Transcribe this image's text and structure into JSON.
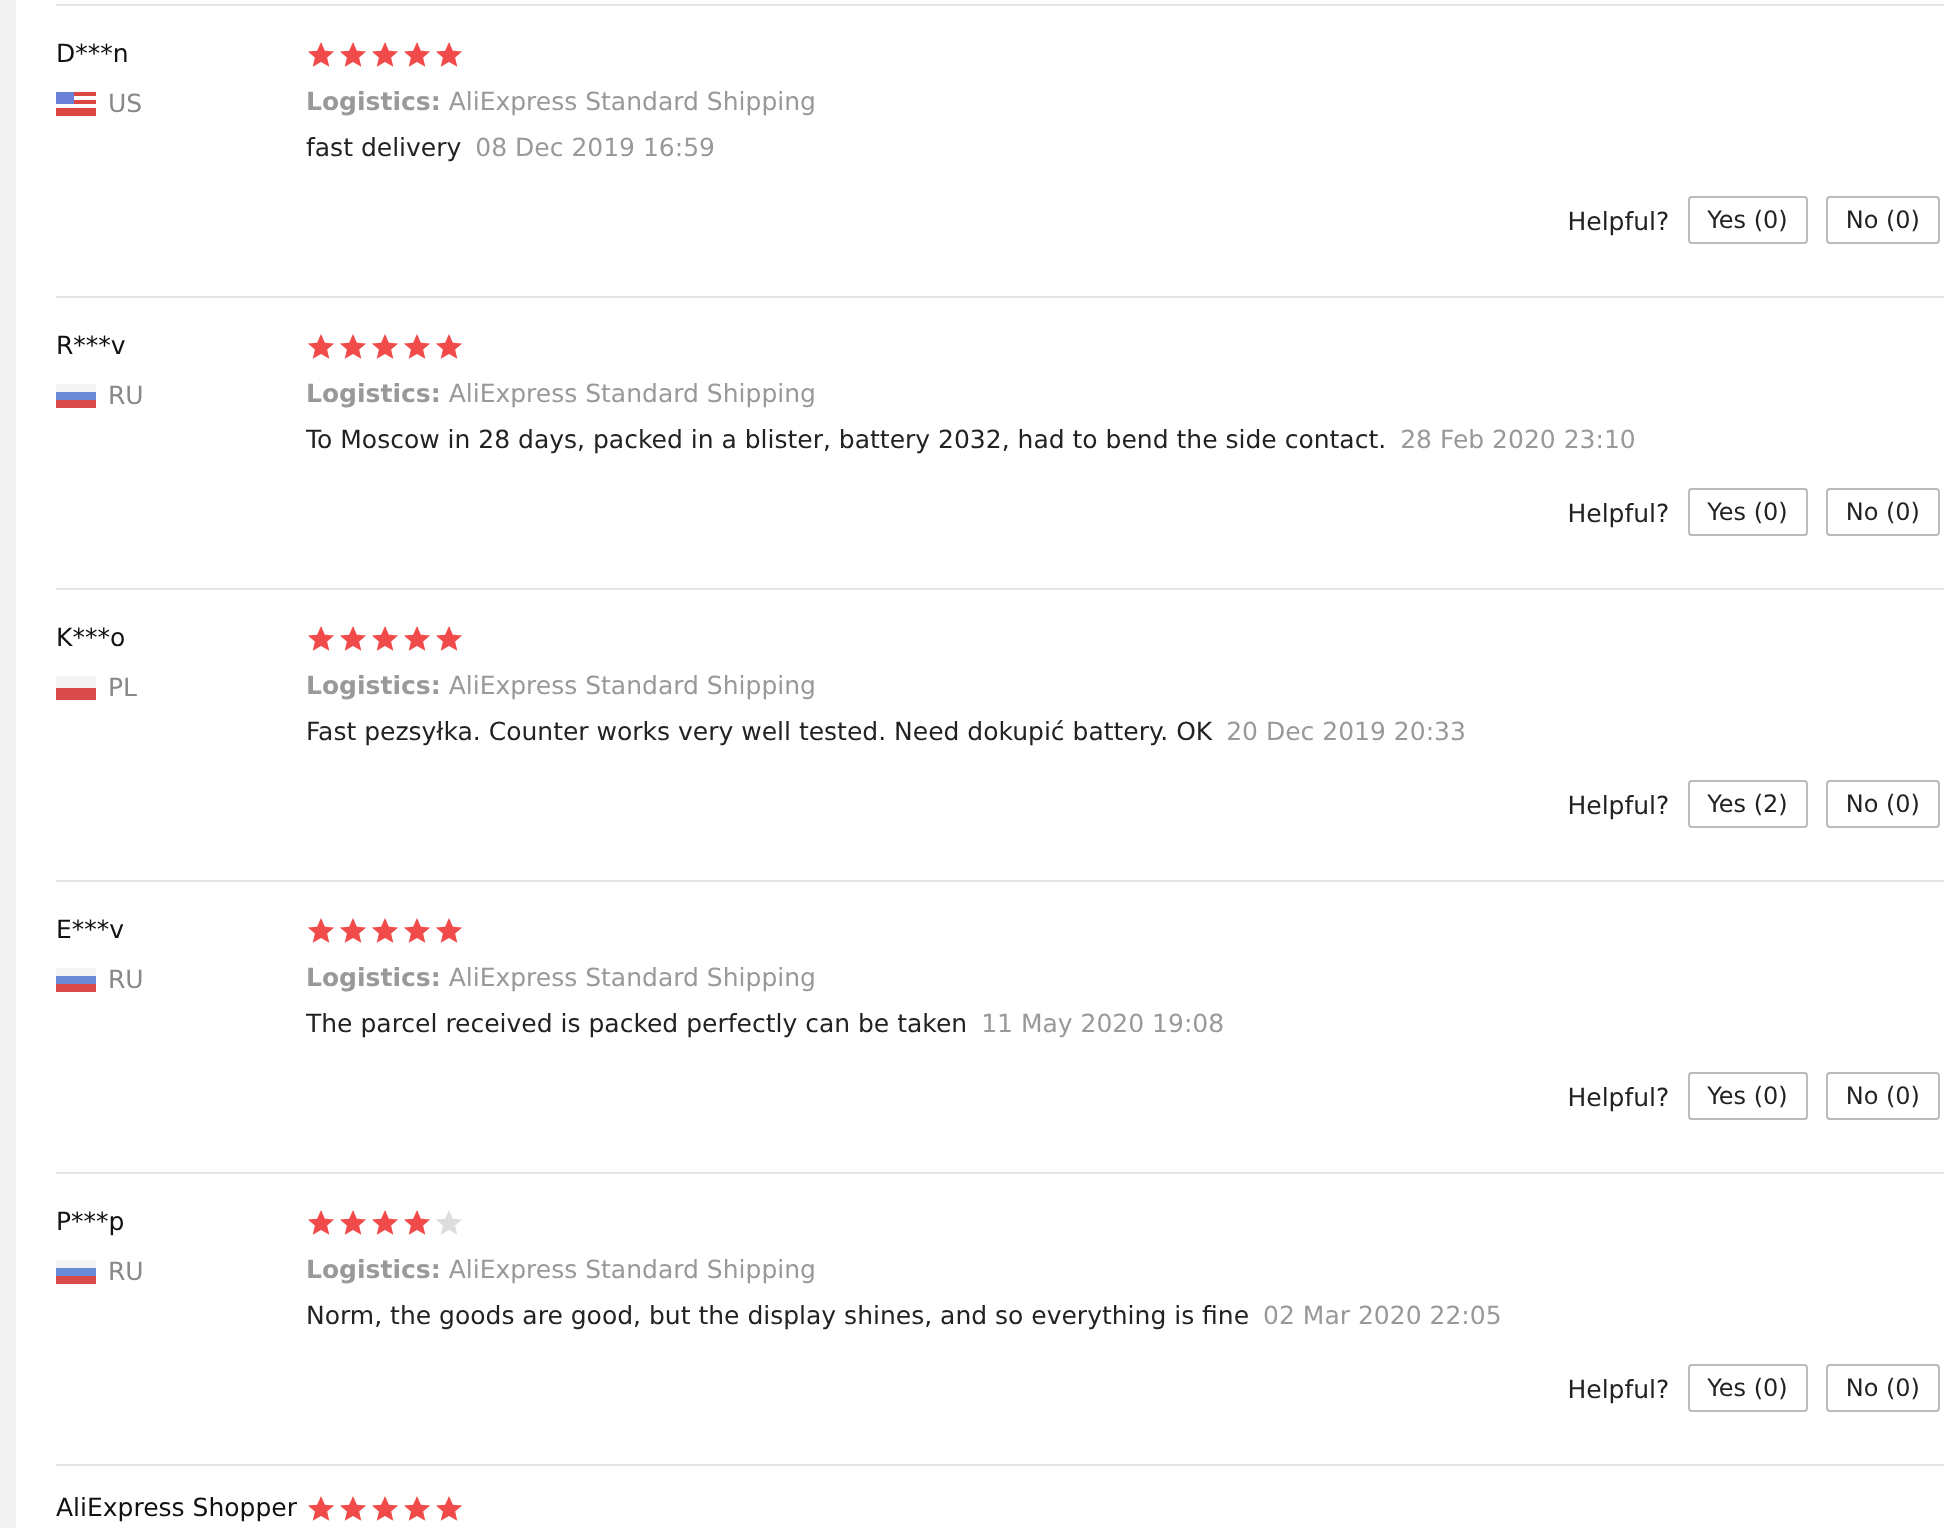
{
  "reviews": [
    {
      "name": "D***n",
      "kind": "us",
      "country": "US",
      "stars": 5,
      "logistics_label": "Logistics:",
      "logistics": "AliExpress Standard Shipping",
      "text": "fast delivery",
      "date": "08 Dec 2019 16:59",
      "helpful_label": "Helpful?",
      "yes": "Yes (0)",
      "no": "No (0)"
    },
    {
      "name": "R***v",
      "kind": "ru",
      "country": "RU",
      "stars": 5,
      "logistics_label": "Logistics:",
      "logistics": "AliExpress Standard Shipping",
      "text": "To Moscow in 28 days, packed in a blister, battery 2032, had to bend the side contact.",
      "date": "28 Feb 2020 23:10",
      "helpful_label": "Helpful?",
      "yes": "Yes (0)",
      "no": "No (0)"
    },
    {
      "name": "K***o",
      "kind": "pl",
      "country": "PL",
      "stars": 5,
      "logistics_label": "Logistics:",
      "logistics": "AliExpress Standard Shipping",
      "text": "Fast pezsyłka. Counter works very well tested. Need dokupić battery. OK",
      "date": "20 Dec 2019 20:33",
      "helpful_label": "Helpful?",
      "yes": "Yes (2)",
      "no": "No (0)"
    },
    {
      "name": "E***v",
      "kind": "ru",
      "country": "RU",
      "stars": 5,
      "logistics_label": "Logistics:",
      "logistics": "AliExpress Standard Shipping",
      "text": "The parcel received is packed perfectly can be taken",
      "date": "11 May 2020 19:08",
      "helpful_label": "Helpful?",
      "yes": "Yes (0)",
      "no": "No (0)"
    },
    {
      "name": "P***p",
      "kind": "ru",
      "country": "RU",
      "stars": 4,
      "logistics_label": "Logistics:",
      "logistics": "AliExpress Standard Shipping",
      "text": "Norm, the goods are good, but the display shines, and so everything is fine",
      "date": "02 Mar 2020 22:05",
      "helpful_label": "Helpful?",
      "yes": "Yes (0)",
      "no": "No (0)"
    },
    {
      "name": "AliExpress Shopper",
      "stars": 5
    }
  ]
}
